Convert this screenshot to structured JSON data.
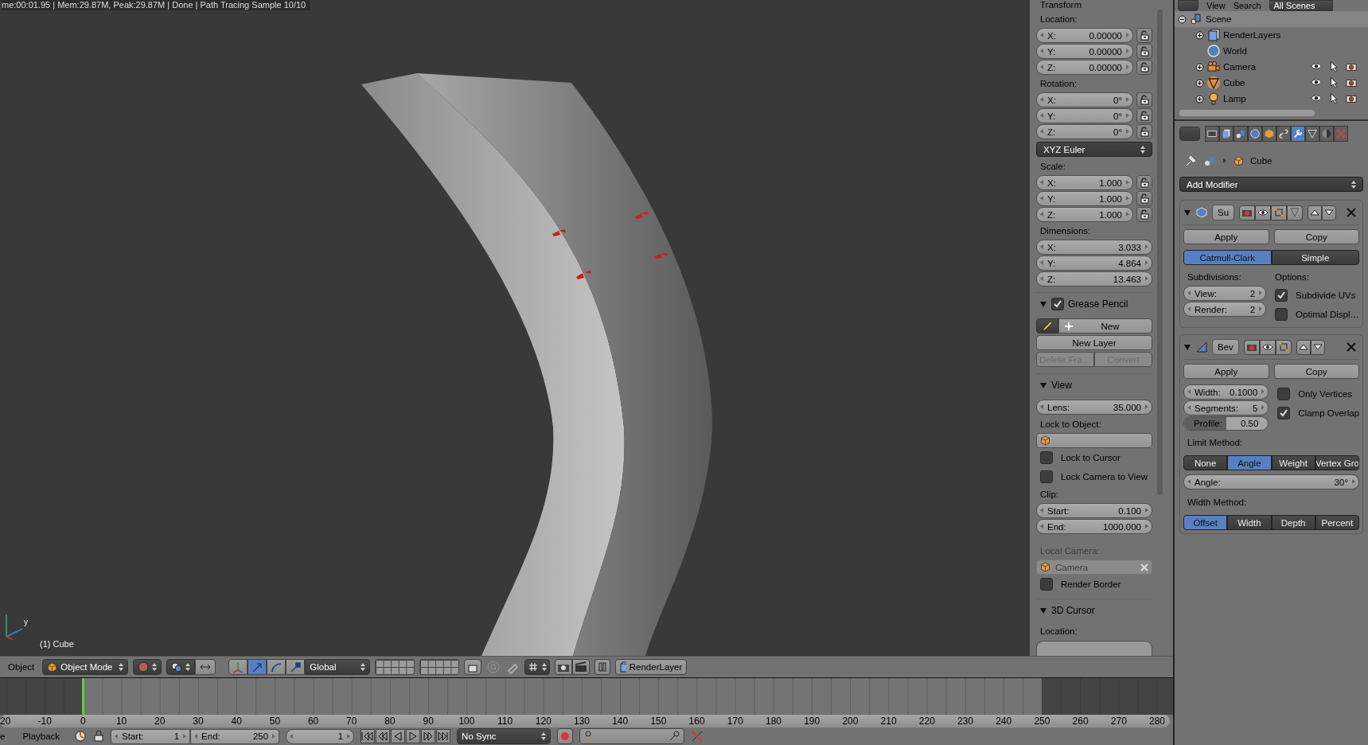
{
  "viewport": {
    "render_info": "me:00:01.95 | Mem:29.87M, Peak:29.87M | Done | Path Tracing Sample 10/10",
    "axis_label": "y",
    "object_label": "(1) Cube"
  },
  "n_panel": {
    "transform": {
      "title": "Transform",
      "groups": [
        {
          "kind": "vector",
          "label": "Location:",
          "lockable": true,
          "fields": [
            {
              "axis": "X:",
              "value": "0.00000"
            },
            {
              "axis": "Y:",
              "value": "0.00000"
            },
            {
              "axis": "Z:",
              "value": "0.00000"
            }
          ]
        },
        {
          "kind": "vector",
          "label": "Rotation:",
          "lockable": true,
          "fields": [
            {
              "axis": "X:",
              "value": "0°"
            },
            {
              "axis": "Y:",
              "value": "0°"
            },
            {
              "axis": "Z:",
              "value": "0°"
            }
          ]
        },
        {
          "kind": "dropdown",
          "value": "XYZ Euler"
        },
        {
          "kind": "vector",
          "label": "Scale:",
          "lockable": true,
          "fields": [
            {
              "axis": "X:",
              "value": "1.000"
            },
            {
              "axis": "Y:",
              "value": "1.000"
            },
            {
              "axis": "Z:",
              "value": "1.000"
            }
          ]
        },
        {
          "kind": "vector",
          "label": "Dimensions:",
          "lockable": false,
          "fields": [
            {
              "axis": "X:",
              "value": "3.033"
            },
            {
              "axis": "Y:",
              "value": "4.864"
            },
            {
              "axis": "Z:",
              "value": "13.463"
            }
          ]
        }
      ]
    },
    "grease_pencil": {
      "title": "Grease Pencil",
      "expanded": true,
      "enabled": true,
      "new_button": "New",
      "new_layer_button": "New Layer",
      "actions": [
        {
          "label": "Delete Fra…",
          "disabled": true
        },
        {
          "label": "Convert",
          "disabled": true
        }
      ]
    },
    "view": {
      "title": "View",
      "expanded": true,
      "lens": {
        "label": "Lens:",
        "value": "35.000"
      },
      "lock_to_object_label": "Lock to Object:",
      "checks": [
        {
          "label": "Lock to Cursor",
          "checked": false
        },
        {
          "label": "Lock Camera to View",
          "checked": false
        }
      ],
      "clip_label": "Clip:",
      "clip": [
        {
          "label": "Start:",
          "value": "0.100"
        },
        {
          "label": "End:",
          "value": "1000.000"
        }
      ],
      "local_camera_label": "Local Camera:",
      "local_camera": {
        "value": "Camera",
        "disabled": true
      },
      "render_border": {
        "label": "Render Border",
        "checked": false
      }
    },
    "cursor": {
      "title": "3D Cursor",
      "expanded": true,
      "location_label": "Location:"
    }
  },
  "header": {
    "menu": "Object",
    "mode": "Object Mode",
    "manipulators": [
      {
        "selected": false
      },
      {
        "selected": true
      },
      {
        "selected": false
      },
      {
        "selected": false
      }
    ],
    "orientation": "Global",
    "render_layer": "RenderLayer"
  },
  "timeline": {
    "ruler": [
      "20",
      "-10",
      "0",
      "10",
      "20",
      "30",
      "40",
      "50",
      "60",
      "70",
      "80",
      "90",
      "100",
      "110",
      "120",
      "130",
      "140",
      "150",
      "160",
      "170",
      "180",
      "190",
      "200",
      "210",
      "220",
      "230",
      "240",
      "250",
      "260",
      "270",
      "280"
    ],
    "menus": [
      "e",
      "Playback"
    ],
    "start": {
      "label": "Start:",
      "value": "1"
    },
    "end": {
      "label": "End:",
      "value": "250"
    },
    "current_frame": "1",
    "sync": "No Sync"
  },
  "outliner": {
    "menus": [
      "View",
      "Search"
    ],
    "scene_filter": "All Scenes",
    "tree": [
      {
        "name": "Scene",
        "kind": "scene",
        "selected": true,
        "expanded": true,
        "children": [
          {
            "name": "RenderLayers",
            "kind": "renderlayers",
            "selected": false,
            "expanded": false
          },
          {
            "name": "World",
            "kind": "world",
            "selected": false
          },
          {
            "name": "Camera",
            "kind": "camera",
            "selected": false,
            "expanded": false,
            "visible": true,
            "selectable": true,
            "renderable": true
          },
          {
            "name": "Cube",
            "kind": "mesh",
            "selected": false,
            "expanded": false,
            "visible": true,
            "selectable": true,
            "renderable": true
          },
          {
            "name": "Lamp",
            "kind": "lamp",
            "selected": false,
            "expanded": false,
            "visible": true,
            "selectable": true,
            "renderable": true
          }
        ]
      }
    ]
  },
  "properties": {
    "tabs": [
      {
        "selected": false
      },
      {
        "selected": false
      },
      {
        "selected": false
      },
      {
        "selected": false
      },
      {
        "selected": false
      },
      {
        "selected": false
      },
      {
        "selected": true
      },
      {
        "selected": false
      },
      {
        "selected": false
      },
      {
        "selected": false
      }
    ],
    "breadcrumb": "Cube",
    "add_modifier": "Add Modifier",
    "modifiers": [
      {
        "kind": "subsurf",
        "name": "Su",
        "expanded": true,
        "apply": "Apply",
        "copy": "Copy",
        "types": [
          {
            "label": "Catmull-Clark",
            "selected": true
          },
          {
            "label": "Simple",
            "selected": false
          }
        ],
        "subdivisions_label": "Subdivisions:",
        "levels": [
          {
            "label": "View:",
            "value": "2"
          },
          {
            "label": "Render:",
            "value": "2"
          }
        ],
        "options_label": "Options:",
        "options": [
          {
            "label": "Subdivide UVs",
            "checked": true
          },
          {
            "label": "Optimal Displ…",
            "checked": false
          }
        ]
      },
      {
        "kind": "bevel",
        "name": "Bev",
        "expanded": true,
        "apply": "Apply",
        "copy": "Copy",
        "fields": [
          {
            "label": "Width:",
            "value": "0.1000"
          },
          {
            "label": "Segments:",
            "value": "5"
          }
        ],
        "profile": {
          "label": "Profile:",
          "value": "0.50",
          "level": 0.5
        },
        "options": [
          {
            "label": "Only Vertices",
            "checked": false
          },
          {
            "label": "Clamp Overlap",
            "checked": true
          }
        ],
        "limit_label": "Limit Method:",
        "limit_methods": [
          {
            "label": "None",
            "selected": false
          },
          {
            "label": "Angle",
            "selected": true
          },
          {
            "label": "Weight",
            "selected": false
          },
          {
            "label": "Vertex Gro",
            "selected": false
          }
        ],
        "angle": {
          "label": "Angle:",
          "value": "30°"
        },
        "width_label": "Width Method:",
        "width_methods": [
          {
            "label": "Offset",
            "selected": true
          },
          {
            "label": "Width",
            "selected": false
          },
          {
            "label": "Depth",
            "selected": false
          },
          {
            "label": "Percent",
            "selected": false
          }
        ]
      }
    ]
  }
}
